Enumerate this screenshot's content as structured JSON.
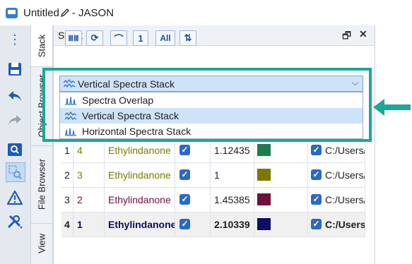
{
  "window": {
    "title": "Untitled",
    "app_name": "- JASON"
  },
  "panel": {
    "title": "Stack",
    "float_glyph": "🗗",
    "close_glyph": "✕"
  },
  "vertical_tabs": [
    "Stack",
    "Object Browser",
    "File Browser",
    "View"
  ],
  "toolbar": [
    "ⅢⅢ",
    "⟳",
    "⌒",
    "1",
    "All",
    "⇅"
  ],
  "dropdown": {
    "selected": "Vertical Spectra Stack",
    "options": [
      {
        "label": "Spectra Overlap",
        "icon": "spectra-overlap-icon",
        "highlighted": false
      },
      {
        "label": "Vertical Spectra Stack",
        "icon": "vertical-stack-icon",
        "highlighted": true
      },
      {
        "label": "Horizontal Spectra Stack",
        "icon": "horizontal-stack-icon",
        "highlighted": false
      }
    ]
  },
  "rows": [
    {
      "index": "1",
      "order": "4",
      "name": "Ethylindanone",
      "scale": "1.12435",
      "color": "#1f7a4d",
      "path": "C:/Users/",
      "text_color": "#7a7a00",
      "bold": false
    },
    {
      "index": "2",
      "order": "3",
      "name": "Ethylindanone",
      "scale": "1",
      "color": "#7b7700",
      "path": "C:/Users/",
      "text_color": "#7a7a00",
      "bold": false
    },
    {
      "index": "3",
      "order": "2",
      "name": "Ethylindanone",
      "scale": "1.45385",
      "color": "#6e0f3c",
      "path": "C:/Users/",
      "text_color": "#6e0f3c",
      "bold": false
    },
    {
      "index": "4",
      "order": "1",
      "name": "Ethylindanone",
      "scale": "2.10339",
      "color": "#0d0d66",
      "path": "C:/Users/",
      "text_color": "#0d0d66",
      "bold": true
    }
  ],
  "colors": {
    "accent": "#18a999",
    "selection": "#cfe3f8",
    "toolbar_blue": "#1e5bb8"
  }
}
